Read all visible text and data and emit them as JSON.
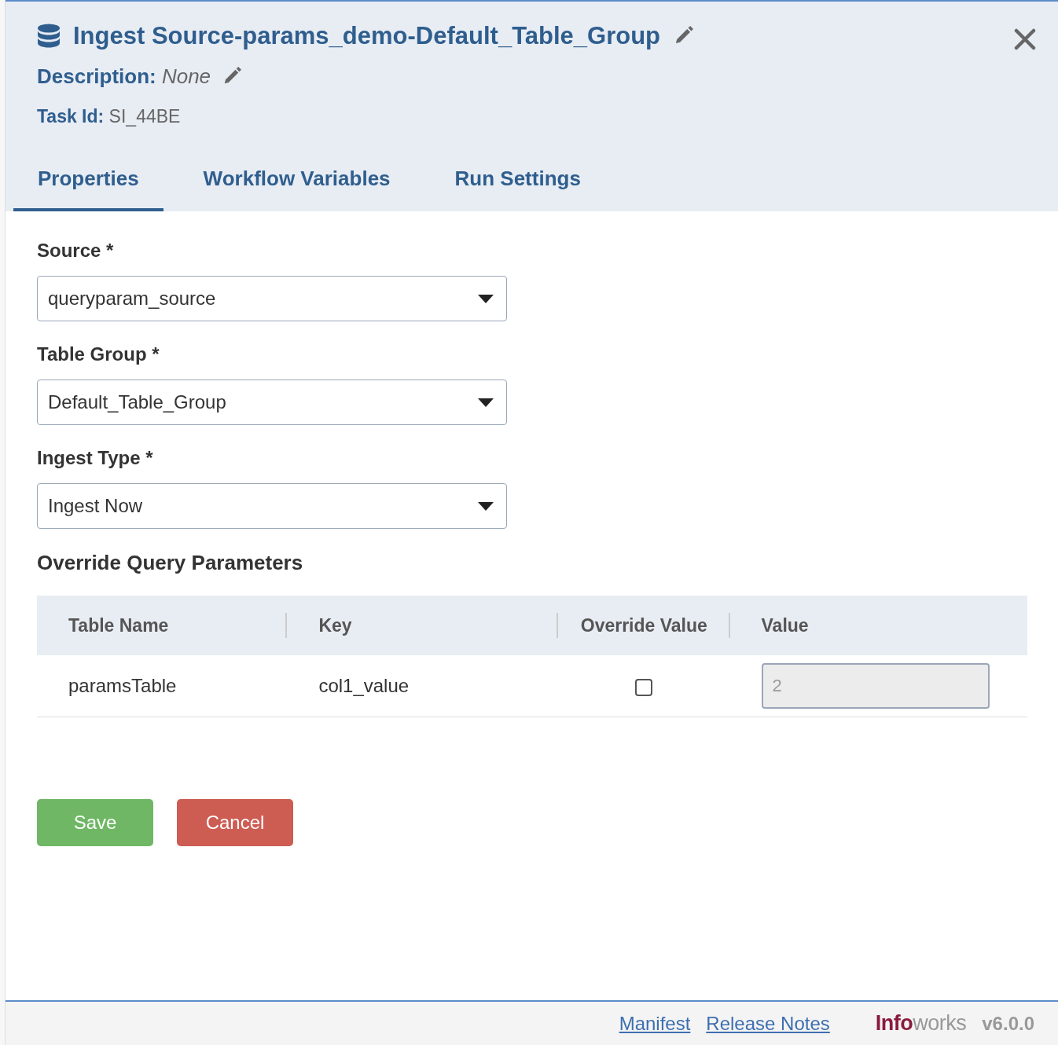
{
  "header": {
    "title": "Ingest Source-params_demo-Default_Table_Group",
    "description_label": "Description:",
    "description_value": "None",
    "task_id_label": "Task Id:",
    "task_id_value": "SI_44BE"
  },
  "tabs": [
    {
      "label": "Properties",
      "selected": true
    },
    {
      "label": "Workflow Variables",
      "selected": false
    },
    {
      "label": "Run Settings",
      "selected": false
    }
  ],
  "fields": [
    {
      "label": "Source *",
      "value": "queryparam_source"
    },
    {
      "label": "Table Group *",
      "value": "Default_Table_Group"
    },
    {
      "label": "Ingest Type *",
      "value": "Ingest Now"
    }
  ],
  "override_section": {
    "title": "Override Query Parameters",
    "columns": [
      "Table Name",
      "Key",
      "Override Value",
      "Value"
    ],
    "rows": [
      {
        "table_name": "paramsTable",
        "key": "col1_value",
        "override": false,
        "value": "2",
        "value_disabled": true
      }
    ]
  },
  "buttons": [
    {
      "label": "Save",
      "kind": "primary"
    },
    {
      "label": "Cancel",
      "kind": "danger"
    }
  ],
  "footer": {
    "links": [
      "Manifest",
      "Release Notes"
    ],
    "logo": {
      "part_1": "Info",
      "part_2": "works"
    },
    "version": "v6.0.0"
  }
}
